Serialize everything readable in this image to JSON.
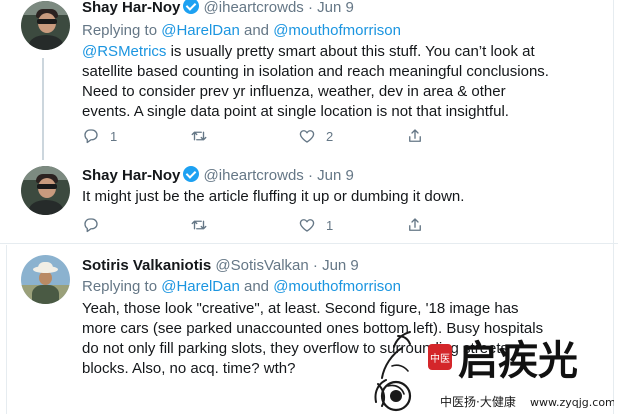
{
  "tweets": [
    {
      "name": "Shay Har-Noy",
      "handle": "@iheartcrowds",
      "sep": "·",
      "date": "Jun 9",
      "reply_prefix": "Replying to",
      "reply_user1": "@HarelDan",
      "reply_and": "and",
      "reply_user2": "@mouthofmorrison",
      "line1_mention": "@RSMetrics",
      "line1_rest": " is usually pretty smart about this stuff. You can’t look at",
      "line2": "satellite based counting in isolation and reach meaningful conclusions.",
      "line3": "Need to consider prev yr influenza, weather, dev in area & other",
      "line4": "events. A single data point at single location is not that insightful.",
      "replies": "1",
      "retweets": "",
      "likes": "2"
    },
    {
      "name": "Shay Har-Noy",
      "handle": "@iheartcrowds",
      "sep": "·",
      "date": "Jun 9",
      "line1": "It might just be the article fluffing it up or dumbing it down.",
      "replies": "",
      "retweets": "",
      "likes": "1"
    },
    {
      "name": "Sotiris Valkaniotis",
      "handle": "@SotisValkan",
      "sep": "·",
      "date": "Jun 9",
      "reply_prefix": "Replying to",
      "reply_user1": "@HarelDan",
      "reply_and": "and",
      "reply_user2": "@mouthofmorrison",
      "line1": "Yeah, those look \"creative\", at least. Second figure, '18 image has",
      "line2": "more cars (see parked unaccounted ones bottom left). Busy hospitals",
      "line3": "do not only fill parking slots, they overflow to surrounding streets",
      "line4": "blocks. Also, no acq. time? wth?"
    }
  ],
  "watermark": {
    "seal": "中医",
    "brand": "启疾光",
    "slogan": "中医扬·大健康",
    "url": "www.zyqjg.com"
  },
  "colors": {
    "link": "#1b95e0",
    "verified": "#1da1f2",
    "meta": "#657786",
    "watermark_red": "#d4262a"
  }
}
